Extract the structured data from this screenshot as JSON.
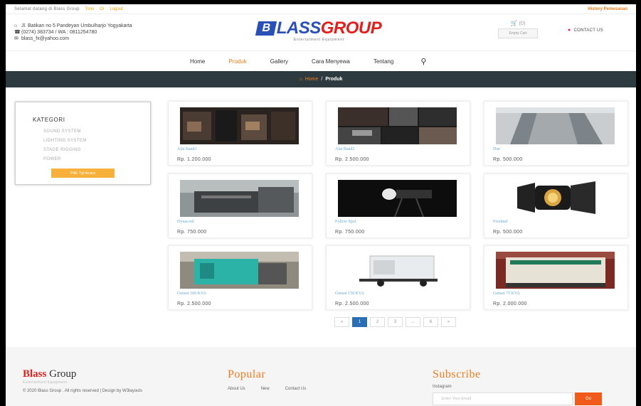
{
  "topbar": {
    "welcome": "Selamat datang di Blass Group",
    "login": "Tono",
    "register": "Or",
    "logout": "Logout",
    "history": "History Pemesanan"
  },
  "contact": {
    "address": "Jl. Batikan no 5 Pandeyan Umbulharjo Yogyakarta",
    "phone": "(0274) 383734 / WA : 0811254780",
    "email": "blass_fx@yahoo.com"
  },
  "logo": {
    "mark": "B",
    "blass": "LASS",
    "group": "GROUP",
    "tagline": "Entertaiment Equipment"
  },
  "cart": {
    "count": "(0)",
    "label": "Empty Cart"
  },
  "contact_us": "CONTACT US",
  "nav": {
    "items": [
      "Home",
      "Produk",
      "Gallery",
      "Cara Menyewa",
      "Tentang"
    ]
  },
  "breadcrumb": {
    "home": "Home",
    "sep": "/",
    "current": "Produk"
  },
  "sidebar": {
    "title": "KATEGORI",
    "categories": [
      "SOUND SYSTEM",
      "LIGHTING SYSTEM",
      "STAGE RIGGING",
      "POWER"
    ],
    "button": "Pilih Tgl Acara"
  },
  "products": [
    {
      "name": "Alat Band1",
      "price": "Rp. 1.200.000"
    },
    {
      "name": "Alat Band2",
      "price": "Rp. 2.500.000"
    },
    {
      "name": "Dsn",
      "price": "Rp. 500.000"
    },
    {
      "name": "Dynacord",
      "price": "Rp. 750.000"
    },
    {
      "name": "Follow Spot",
      "price": "Rp. 750.000"
    },
    {
      "name": "Fresknel",
      "price": "Rp. 500.000"
    },
    {
      "name": "Genset 100 KVA",
      "price": "Rp. 2.500.000"
    },
    {
      "name": "Genset 150 KVA",
      "price": "Rp. 2.500.000"
    },
    {
      "name": "Genset 75 KVA",
      "price": "Rp. 2.000.000"
    }
  ],
  "pagination": [
    "«",
    "1",
    "2",
    "3",
    "...",
    "6",
    "»"
  ],
  "footer": {
    "brand1": "Blass",
    "brand2": " Group",
    "tagline": "Entertaiment Equipment",
    "copyright": "© 2020 Blass Group . All rights reserved | Design by W3layouts",
    "popular_title": "Popular",
    "popular_links": [
      "About Us",
      "New",
      "Contact Us"
    ],
    "subscribe_title": "Subscribe",
    "instagram": "Instagram",
    "email_placeholder": "Enter Your Email",
    "go": "Go"
  },
  "colors": {
    "accent": "#f07b1d",
    "brand_blue": "#2a50b8",
    "brand_red": "#e0201c",
    "breadcrumb_bg": "#2d3a3f"
  }
}
